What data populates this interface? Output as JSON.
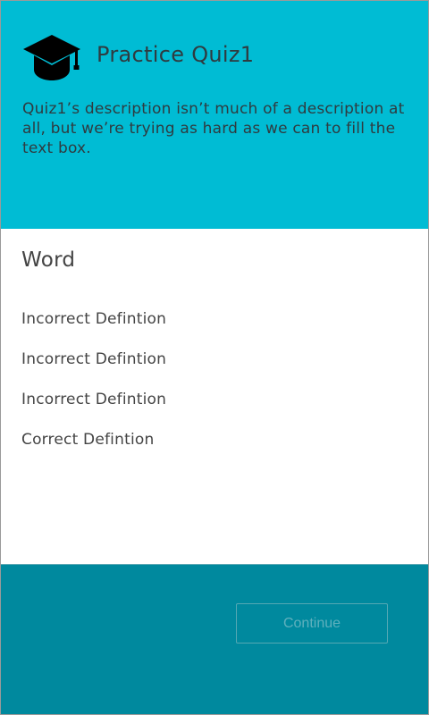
{
  "header": {
    "logo_icon": "graduation-cap-icon",
    "title": "Practice Quiz1",
    "description": "Quiz1’s description isn’t much of a description at all, but we’re trying as hard as we can to fill the text box."
  },
  "question": {
    "word": "Word",
    "options": [
      {
        "label": "Incorrect Defintion"
      },
      {
        "label": "Incorrect Defintion"
      },
      {
        "label": "Incorrect Defintion"
      },
      {
        "label": "Correct Defintion"
      }
    ]
  },
  "footer": {
    "continue_label": "Continue",
    "continue_disabled": true
  },
  "colors": {
    "header_bg": "#00bcd4",
    "footer_bg": "#00899e",
    "text_dark": "#2f3b40",
    "button_text_disabled": "#5fb0bd"
  }
}
